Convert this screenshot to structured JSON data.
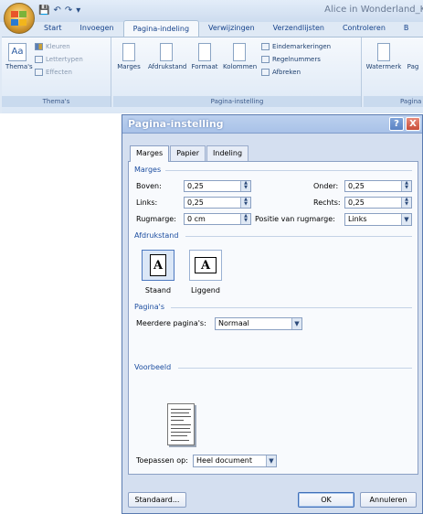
{
  "window": {
    "doc_title": "Alice in Wonderland_Kl"
  },
  "qat": {
    "save": "💾",
    "undo": "↶",
    "redo": "↷",
    "more": "▾"
  },
  "ribbon": {
    "tabs": [
      "Start",
      "Invoegen",
      "Pagina-indeling",
      "Verwijzingen",
      "Verzendlijsten",
      "Controleren",
      "B"
    ],
    "active_tab": "Pagina-indeling",
    "themes_group": {
      "label": "Thema's",
      "themes_btn": "Thema's",
      "colors": "Kleuren",
      "fonts": "Lettertypen",
      "effects": "Effecten"
    },
    "page_setup_group": {
      "label": "Pagina-instelling",
      "margins": "Marges",
      "orientation": "Afdrukstand",
      "size": "Formaat",
      "columns": "Kolommen",
      "breaks": "Eindemarkeringen",
      "line_numbers": "Regelnummers",
      "hyphenation": "Afbreken"
    },
    "background_group": {
      "label": "Pagina",
      "watermark": "Watermerk",
      "page": "Pag"
    }
  },
  "dialog": {
    "title": "Pagina-instelling",
    "help": "?",
    "close": "X",
    "tabs": [
      "Marges",
      "Papier",
      "Indeling"
    ],
    "margins_section": "Marges",
    "top_label": "Boven:",
    "top_value": "0,25",
    "bottom_label": "Onder:",
    "bottom_value": "0,25",
    "left_label": "Links:",
    "left_value": "0,25",
    "right_label": "Rechts:",
    "right_value": "0,25",
    "gutter_label": "Rugmarge:",
    "gutter_value": "0 cm",
    "gutter_pos_label": "Positie van rugmarge:",
    "gutter_pos_value": "Links",
    "orientation_section": "Afdrukstand",
    "portrait": "Staand",
    "landscape": "Liggend",
    "pages_section": "Pagina's",
    "multiple_pages_label": "Meerdere pagina's:",
    "multiple_pages_value": "Normaal",
    "preview_section": "Voorbeeld",
    "apply_label": "Toepassen op:",
    "apply_value": "Heel document",
    "default_btn": "Standaard...",
    "ok_btn": "OK",
    "cancel_btn": "Annuleren"
  },
  "colors": {
    "accent": "#15428b",
    "section": "#1d4ea0",
    "close": "#c94d38"
  }
}
